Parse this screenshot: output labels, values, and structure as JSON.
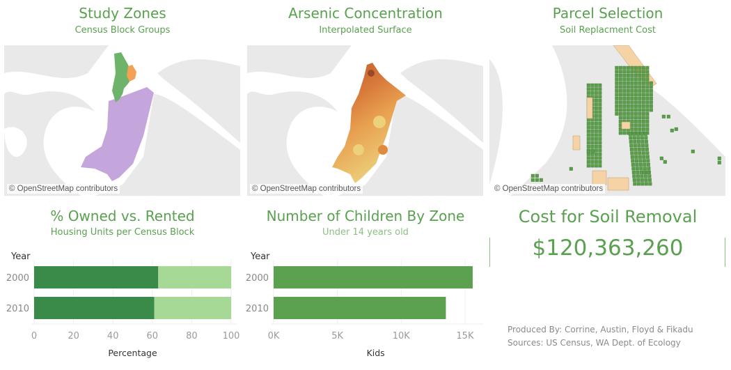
{
  "panels": {
    "study_zones": {
      "title": "Study Zones",
      "subtitle": "Census Block Groups",
      "attribution": "© OpenStreetMap contributors"
    },
    "arsenic": {
      "title": "Arsenic Concentration",
      "subtitle": "Interpolated Surface",
      "attribution": "© OpenStreetMap contributors"
    },
    "parcel": {
      "title": "Parcel Selection",
      "subtitle": "Soil Replacment Cost",
      "attribution": "© OpenStreetMap contributors"
    },
    "owned_rented": {
      "title": "% Owned vs. Rented",
      "subtitle": "Housing Units per Census Block"
    },
    "children": {
      "title": "Number of Children By Zone",
      "subtitle": "Under 14 years old"
    },
    "cost": {
      "title": "Cost for Soil Removal",
      "value": "$120,363,260"
    }
  },
  "colors": {
    "accent": "#59a14f",
    "owned": "#3a8a4a",
    "rented": "#a6d996",
    "kids": "#5ba150",
    "zone_purple": "#c4a6dc",
    "zone_green": "#6db36a",
    "zone_orange": "#f2a155"
  },
  "credits": {
    "produced_by": "Produced By: Corrine, Austin, Floyd & Fikadu",
    "sources": "Sources: US Census, WA Dept. of Ecology"
  },
  "chart_data": [
    {
      "type": "bar",
      "orientation": "horizontal",
      "stacked": true,
      "title": "% Owned vs. Rented",
      "subtitle": "Housing Units per Census Block",
      "ylabel": "Year",
      "xlabel": "Percentage",
      "categories": [
        "2000",
        "2010"
      ],
      "series": [
        {
          "name": "Owned",
          "values": [
            63,
            61
          ]
        },
        {
          "name": "Rented",
          "values": [
            37,
            39
          ]
        }
      ],
      "xlim": [
        0,
        100
      ],
      "xticks": [
        "0",
        "20",
        "40",
        "60",
        "80",
        "100"
      ],
      "grid": true
    },
    {
      "type": "bar",
      "orientation": "horizontal",
      "title": "Number of Children By Zone",
      "subtitle": "Under 14 years old",
      "ylabel": "Year",
      "xlabel": "Kids",
      "categories": [
        "2000",
        "2010"
      ],
      "values": [
        15600,
        13500
      ],
      "xlim": [
        0,
        16000
      ],
      "xticks": [
        "0K",
        "5K",
        "10K",
        "15K"
      ],
      "grid": true
    }
  ]
}
